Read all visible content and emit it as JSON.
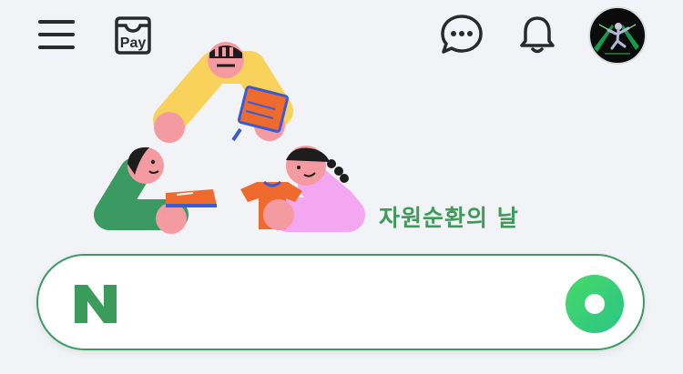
{
  "header": {
    "icons": [
      "menu-icon",
      "pay-icon",
      "chat-icon",
      "bell-icon",
      "avatar"
    ],
    "pay_label": "Pay"
  },
  "doodle": {
    "text": "자원순환의 날"
  },
  "search": {
    "logo": "N",
    "value": "",
    "placeholder": ""
  },
  "colors": {
    "background": "#f2f3f6",
    "accent_green": "#3c9a63",
    "logo_green": "#3a9b5c"
  }
}
